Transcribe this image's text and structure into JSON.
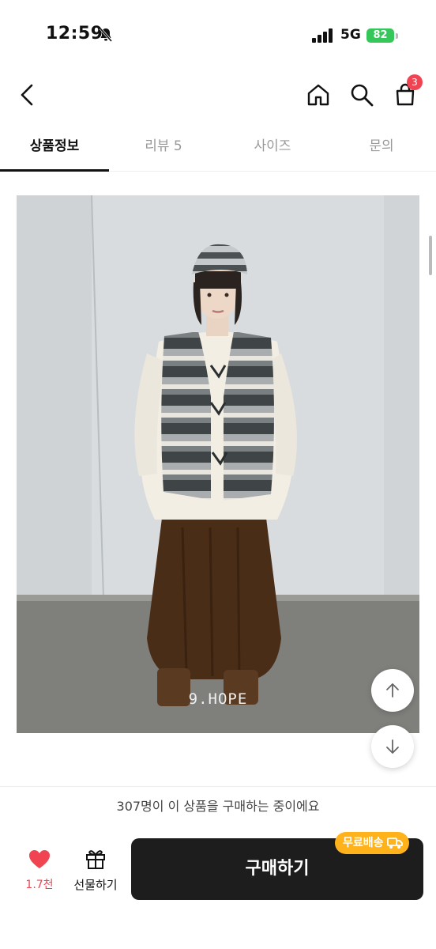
{
  "status_bar": {
    "time": "12:59",
    "network": "5G",
    "battery": "82"
  },
  "nav": {
    "cart_count": "3"
  },
  "tabs": [
    {
      "label": "상품정보",
      "active": true
    },
    {
      "label": "리뷰 5",
      "active": false
    },
    {
      "label": "사이즈",
      "active": false
    },
    {
      "label": "문의",
      "active": false
    }
  ],
  "product_image": {
    "watermark": "9.HOPE"
  },
  "notice": "307명이 이 상품을 구매하는 중이에요",
  "bottom_bar": {
    "like_count": "1.7천",
    "gift_label": "선물하기",
    "buy_label": "구매하기",
    "shipping_badge": "무료배송"
  },
  "colors": {
    "accent_red": "#f04452",
    "buy_button": "#1d1d1d",
    "shipping_badge": "#ffb21a"
  }
}
